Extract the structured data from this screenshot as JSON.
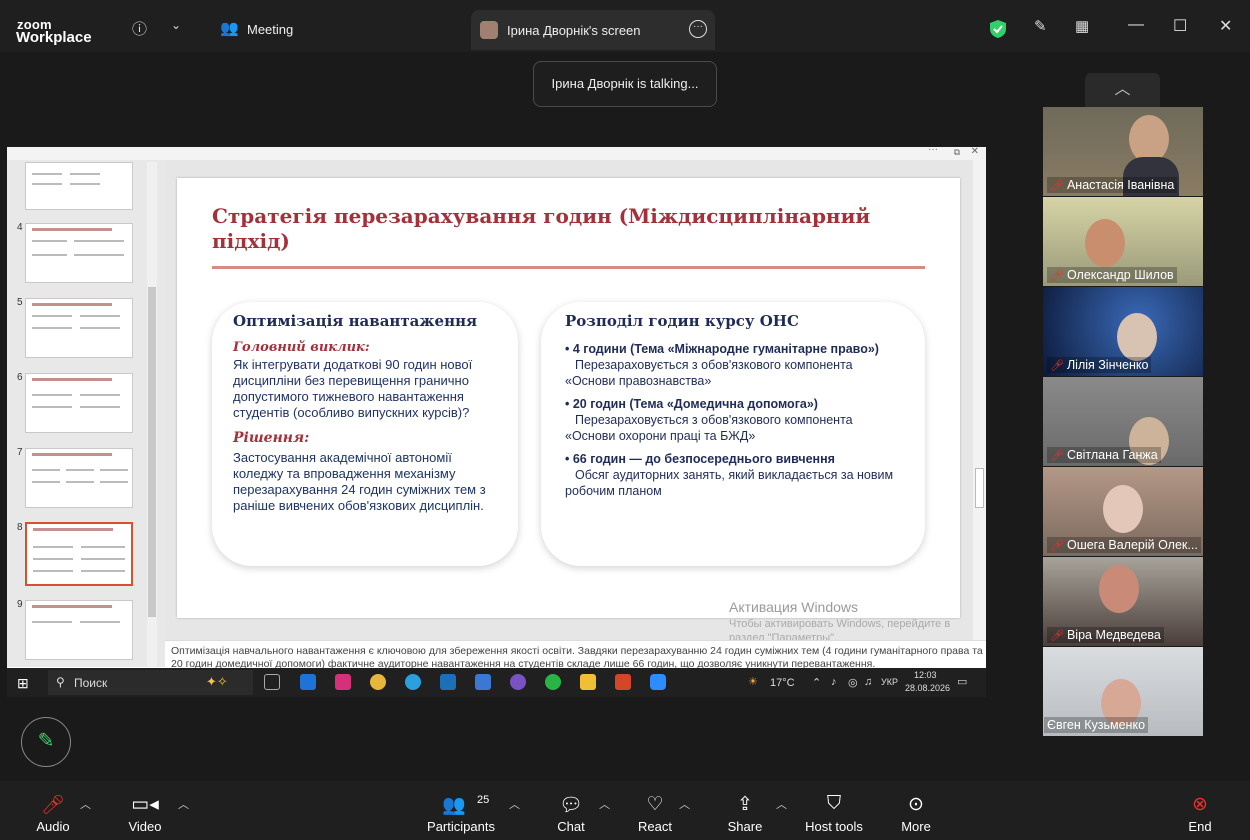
{
  "app": {
    "brand_line1": "zoom",
    "brand_line2": "Workplace",
    "meeting_tab": "Meeting",
    "share_tab": "Ірина Дворнік's screen"
  },
  "talking": "Ірина Дворнік is talking...",
  "colors": {
    "accent_red": "#e8322b",
    "shield_green": "#2fd16a",
    "slide_title": "#a4313a"
  },
  "slide": {
    "title": "Стратегія перезарахування годин (Міждисциплінарний підхід)",
    "left_card": {
      "heading": "Оптимізація навантаження",
      "challenge_label": "Головний виклик:",
      "challenge_text": "Як інтегрувати додаткові 90 годин нової дисципліни без перевищення гранично допустимого тижневого навантаження студентів (особливо випускних курсів)?",
      "solution_label": "Рішення:",
      "solution_text": "Застосування академічної автономії коледжу та впровадження механізму перезарахування 24 годин суміжних тем з раніше вивчених обов'язкових дисциплін."
    },
    "right_card": {
      "heading": "Розподіл годин курсу ОНС",
      "b1_title": "• 4 години (Тема «Міжнародне гуманітарне право»)",
      "b1_text": "Перезараховується з обов'язкового компонента «Основи правознавства»",
      "b2_title": "• 20 годин (Тема «Домедична допомога»)",
      "b2_text": "Перезараховується з обов'язкового компонента «Основи охорони праці та БЖД»",
      "b3_title": "• 66 годин — до безпосереднього вивчення",
      "b3_text": "Обсяг аудиторних занять, який викладається за новим робочим планом"
    }
  },
  "thumb_numbers": [
    "4",
    "5",
    "6",
    "7",
    "8",
    "9"
  ],
  "notes": "Оптимізація навчального навантаження є ключовою для збереження якості освіти. Завдяки перезарахуванню 24 годин суміжних тем (4 години гуманітарного права та 20 годин домедичної допомоги) фактичне аудиторне навантаження на студентів складе лише 66 годин, що дозволяє уникнути перевантаження.",
  "watermark": {
    "line1": "Активация Windows",
    "line2": "Чтобы активировать Windows, перейдите в раздел \"Параметры\"."
  },
  "taskbar": {
    "search": "Поиск",
    "weather": "17°C",
    "lang": "УКР",
    "time": "12:03",
    "date": "28.08.2026"
  },
  "participants_gallery": [
    {
      "name": "Анастасія Іванівна"
    },
    {
      "name": "Олександр Шилов"
    },
    {
      "name": "Лілія Зінченко"
    },
    {
      "name": "Світлана Ганжа"
    },
    {
      "name": "Ошега Валерій Олек..."
    },
    {
      "name": "Віра Медведева"
    },
    {
      "name": "Євген Кузьменко"
    }
  ],
  "toolbar": {
    "audio": "Audio",
    "video": "Video",
    "participants": "Participants",
    "participants_count": "25",
    "chat": "Chat",
    "react": "React",
    "share": "Share",
    "host_tools": "Host tools",
    "more": "More",
    "end": "End"
  }
}
